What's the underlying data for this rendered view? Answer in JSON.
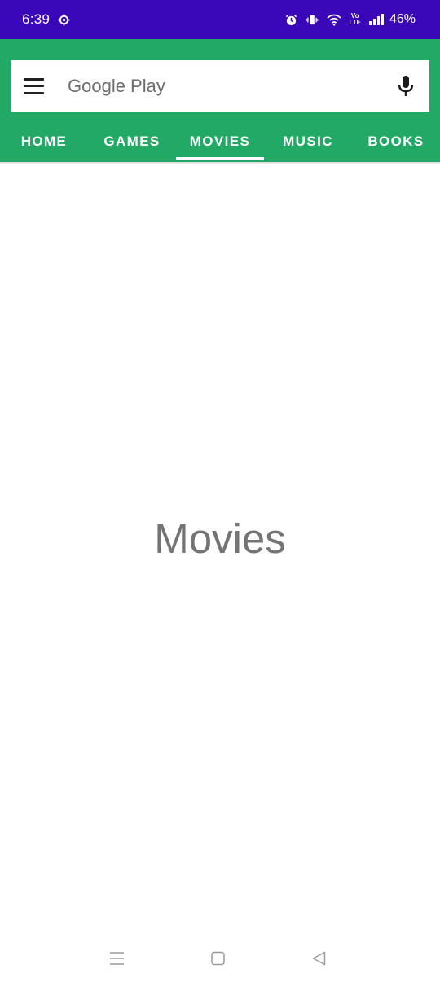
{
  "status_bar": {
    "time": "6:39",
    "battery": "46%",
    "volte_top": "Vo",
    "volte_bottom": "LTE",
    "icons": [
      "gear-icon",
      "alarm-icon",
      "vibrate-icon",
      "wifi-icon",
      "volte-icon",
      "signal-icon"
    ],
    "background": "#3a07b8"
  },
  "search": {
    "placeholder": "Google Play",
    "value": ""
  },
  "tabs": [
    {
      "label": "HOME",
      "selected": false
    },
    {
      "label": "GAMES",
      "selected": false
    },
    {
      "label": "MOVIES",
      "selected": true
    },
    {
      "label": "MUSIC",
      "selected": false
    },
    {
      "label": "BOOKS",
      "selected": false
    }
  ],
  "content": {
    "title": "Movies"
  },
  "colors": {
    "app_bar": "#21a965",
    "text_muted": "#747474"
  },
  "nav_bar": {
    "icons": [
      "recents-icon",
      "home-icon",
      "back-icon"
    ]
  }
}
